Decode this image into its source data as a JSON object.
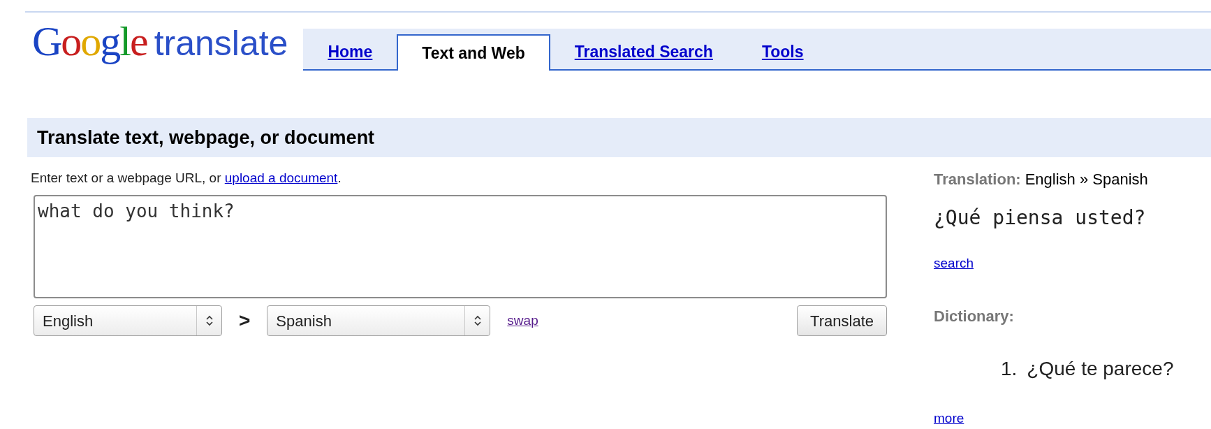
{
  "logo": {
    "brand": "Google",
    "product": "translate"
  },
  "tabs": [
    {
      "label": "Home",
      "selected": false
    },
    {
      "label": "Text and Web",
      "selected": true
    },
    {
      "label": "Translated Search",
      "selected": false
    },
    {
      "label": "Tools",
      "selected": false
    }
  ],
  "section_title": "Translate text, webpage, or document",
  "instruction": {
    "text": "Enter text or a webpage URL, or ",
    "link": "upload a document",
    "end": "."
  },
  "source_text": "what do you think?",
  "from_language": "English",
  "separator": ">",
  "to_language": "Spanish",
  "swap_link": "swap",
  "translate_button": "Translate",
  "result": {
    "label": "Translation:",
    "direction": "English » Spanish",
    "translation": "¿Qué piensa usted?",
    "search_link": "search",
    "dictionary_label": "Dictionary:",
    "dictionary_entries": [
      {
        "number": "1.",
        "text": "¿Qué te parece?"
      }
    ],
    "more_link": "more"
  }
}
